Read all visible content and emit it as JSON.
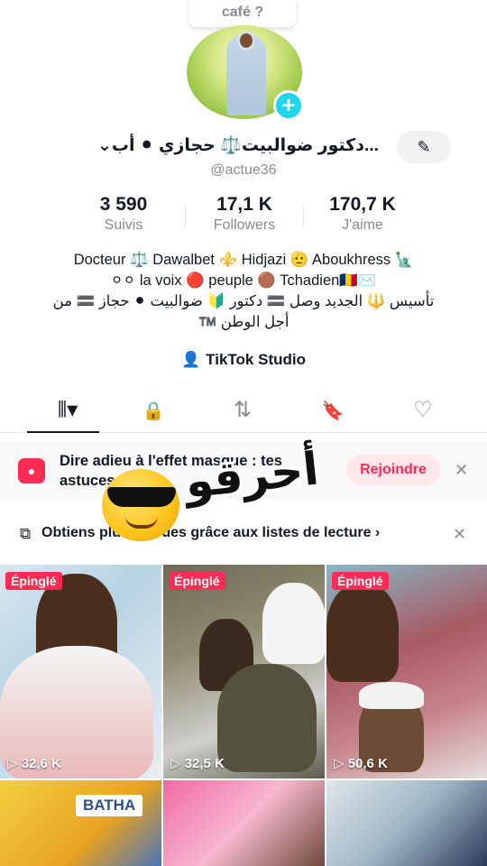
{
  "top_bubble": {
    "text": "café ?"
  },
  "profile": {
    "display_name": "⌄دكتور ضوالبيت⚖️ حجازي ⚫ أب...",
    "username": "@actue36",
    "edit_icon": "pencil-icon"
  },
  "stats": [
    {
      "value": "3 590",
      "label": "Suivis"
    },
    {
      "value": "17,1 K",
      "label": "Followers"
    },
    {
      "value": "170,7 K",
      "label": "J'aime"
    }
  ],
  "bio": {
    "line1": "Docteur ⚖️ Dawalbet ⚜️ Hidjazi 🫡 Aboukhress 🗽",
    "line2": "⚪⚪ la voix 🔴 peuple 🟤 Tchadien🇹🇩✉️",
    "line3": "تأسيس 🔱 الجديد وصل 🟰 دكتور 🔰 ضوالبيت ⚫ حجاز 🟰 من",
    "line4": "أجل الوطن ™️"
  },
  "studio": {
    "label": "TikTok Studio"
  },
  "tabs": [
    {
      "name": "videos-grid",
      "icon": "grid-icon",
      "glyph": "⦀▾"
    },
    {
      "name": "private",
      "icon": "lock-icon",
      "glyph": "🔒"
    },
    {
      "name": "reposts",
      "icon": "repost-icon",
      "glyph": "⇅"
    },
    {
      "name": "favorites",
      "icon": "bookmark-icon",
      "glyph": "🔖"
    },
    {
      "name": "liked",
      "icon": "heart-icon",
      "glyph": "♡"
    }
  ],
  "banner_effect": {
    "text": "Dire adieu à l'effet masque : tes astuces",
    "button": "Rejoindre",
    "close": "✕"
  },
  "banner_playlist": {
    "text": "Obtiens plus de vues grâce aux listes de lecture ›",
    "close": "✕"
  },
  "sticker": {
    "text": "أحرقو"
  },
  "videos": [
    {
      "pinned": "Épinglé",
      "views": "▷ 32,6 K"
    },
    {
      "pinned": "Épinglé",
      "views": "▷ 32,5 K"
    },
    {
      "pinned": "Épinglé",
      "views": "▷ 50,6 K"
    },
    {
      "label": "BATHA"
    },
    {},
    {}
  ],
  "colors": {
    "accent": "#fe2c55",
    "badge": "#20d5ec",
    "muted": "#8a8b91"
  }
}
